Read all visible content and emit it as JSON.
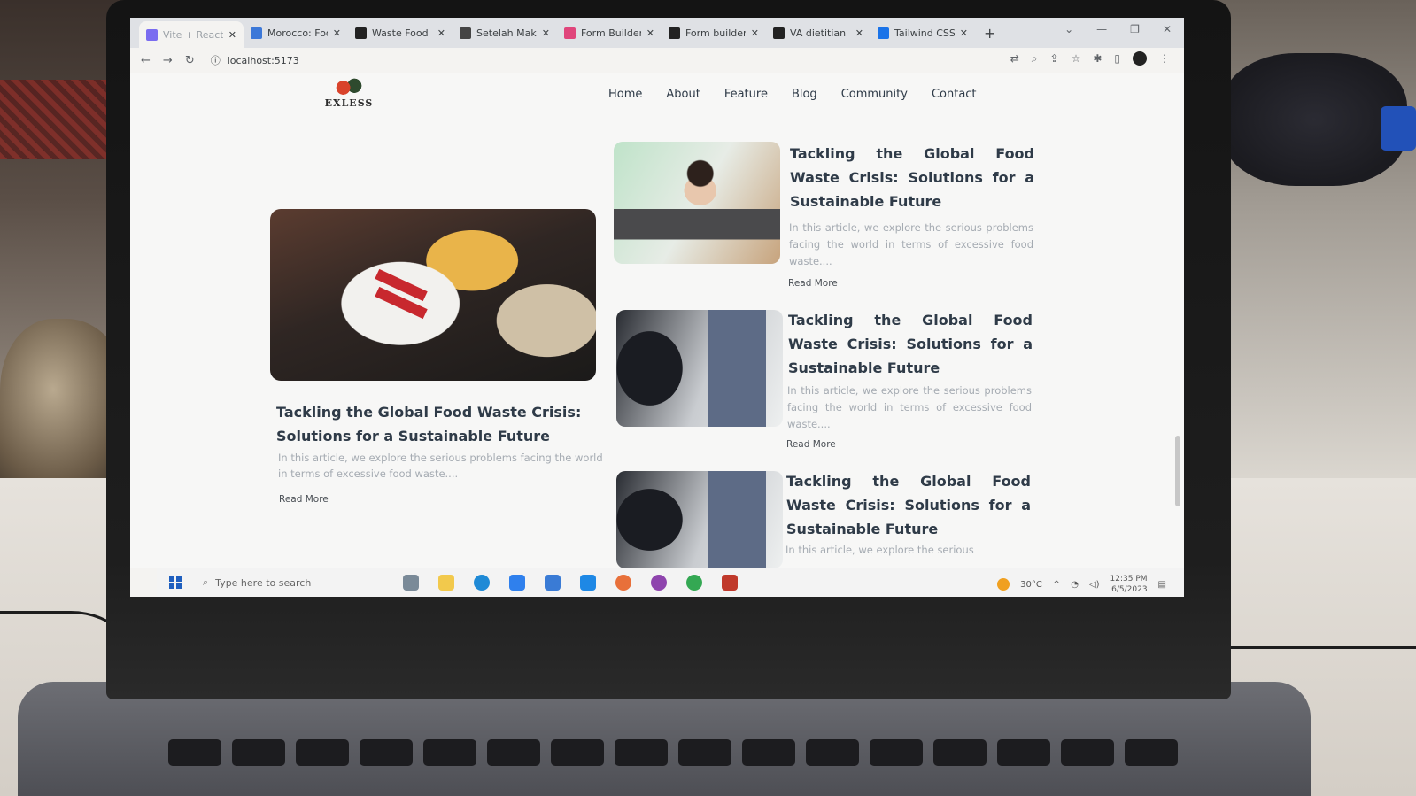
{
  "browser": {
    "tabs": [
      {
        "label": "Vite + React",
        "icon": "vite-icon",
        "color": "#7a6cf0"
      },
      {
        "label": "Morocco: Foo",
        "icon": "image-icon",
        "color": "#3c78d8"
      },
      {
        "label": "Waste Food",
        "icon": "github-icon",
        "color": "#222222"
      },
      {
        "label": "Setelah Maka",
        "icon": "s-icon",
        "color": "#444444"
      },
      {
        "label": "Form Builder",
        "icon": "form-icon",
        "color": "#e0457b"
      },
      {
        "label": "Form builder",
        "icon": "a-icon",
        "color": "#222222"
      },
      {
        "label": "VA dietitian",
        "icon": "va-icon",
        "color": "#222222"
      },
      {
        "label": "Tailwind CSS",
        "icon": "t-icon",
        "color": "#1a73e8"
      }
    ],
    "url": "localhost:5173"
  },
  "site": {
    "logo_text": "EXLESS",
    "nav": [
      "Home",
      "About",
      "Feature",
      "Blog",
      "Community",
      "Contact"
    ]
  },
  "featured": {
    "title": "Tackling the Global Food Waste Crisis: Solutions for a Sustainable Future",
    "desc": "In this article, we explore the serious problems facing the world in terms of excessive food waste....",
    "more": "Read More"
  },
  "articles": [
    {
      "title": "Tackling the Global Food Waste Crisis: Solutions for a Sustainable Future",
      "desc": "In this article, we explore the serious problems facing the world in terms of excessive food waste....",
      "more": "Read More"
    },
    {
      "title": "Tackling the Global Food Waste Crisis: Solutions for a Sustainable Future",
      "desc": "In this article, we explore the serious problems facing the world in terms of excessive food waste....",
      "more": "Read More"
    },
    {
      "title": "Tackling the Global Food Waste Crisis: Solutions for a Sustainable Future",
      "desc": "In this article, we explore the serious",
      "more": ""
    }
  ],
  "taskbar": {
    "search_placeholder": "Type here to search",
    "weather": "30°C",
    "time": "12:35 PM",
    "date": "6/5/2023"
  }
}
